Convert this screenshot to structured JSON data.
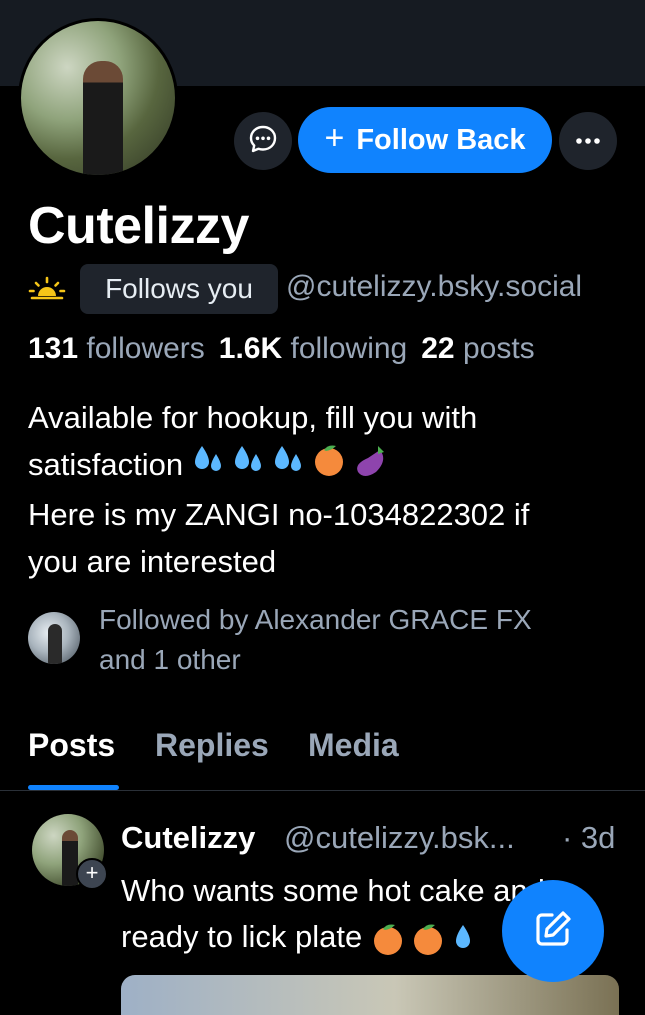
{
  "colors": {
    "accent": "#1083fe",
    "muted_text": "#9aa7b8",
    "background": "#000000",
    "surface": "#1f242c"
  },
  "header": {
    "message_icon": "chat-bubble-icon",
    "follow_button_label": "Follow Back",
    "follow_button_icon": "plus-icon",
    "more_icon": "ellipsis-icon"
  },
  "profile": {
    "display_name": "Cutelizzy",
    "status_icon": "sunrise-icon",
    "follows_you_label": "Follows you",
    "handle": "@cutelizzy.bsky.social",
    "stats": {
      "followers_count": "131",
      "followers_label": "followers",
      "following_count": "1.6K",
      "following_label": "following",
      "posts_count": "22",
      "posts_label": "posts"
    },
    "bio_line1": "Available for hookup, fill you with",
    "bio_line2": "satisfaction",
    "bio_emojis": [
      "sweat-droplets-icon",
      "sweat-droplets-icon",
      "sweat-droplets-icon",
      "peach-icon",
      "eggplant-icon"
    ],
    "bio_line3": "Here is my ZANGI no-1034822302 if",
    "bio_line4": "you are interested",
    "followed_by_line1": "Followed by Alexander GRACE FX",
    "followed_by_line2": "and 1 other"
  },
  "tabs": [
    {
      "label": "Posts",
      "active": true
    },
    {
      "label": "Replies",
      "active": false
    },
    {
      "label": "Media",
      "active": false
    }
  ],
  "post": {
    "author": "Cutelizzy",
    "handle": "@cutelizzy.bsk...",
    "time": "· 3d",
    "text_line1": "Who wants some hot cake and",
    "text_line2": "ready to lick plate",
    "text_emojis": [
      "peach-icon",
      "peach-icon",
      "sweat-droplets-icon"
    ]
  },
  "fab_icon": "compose-icon"
}
